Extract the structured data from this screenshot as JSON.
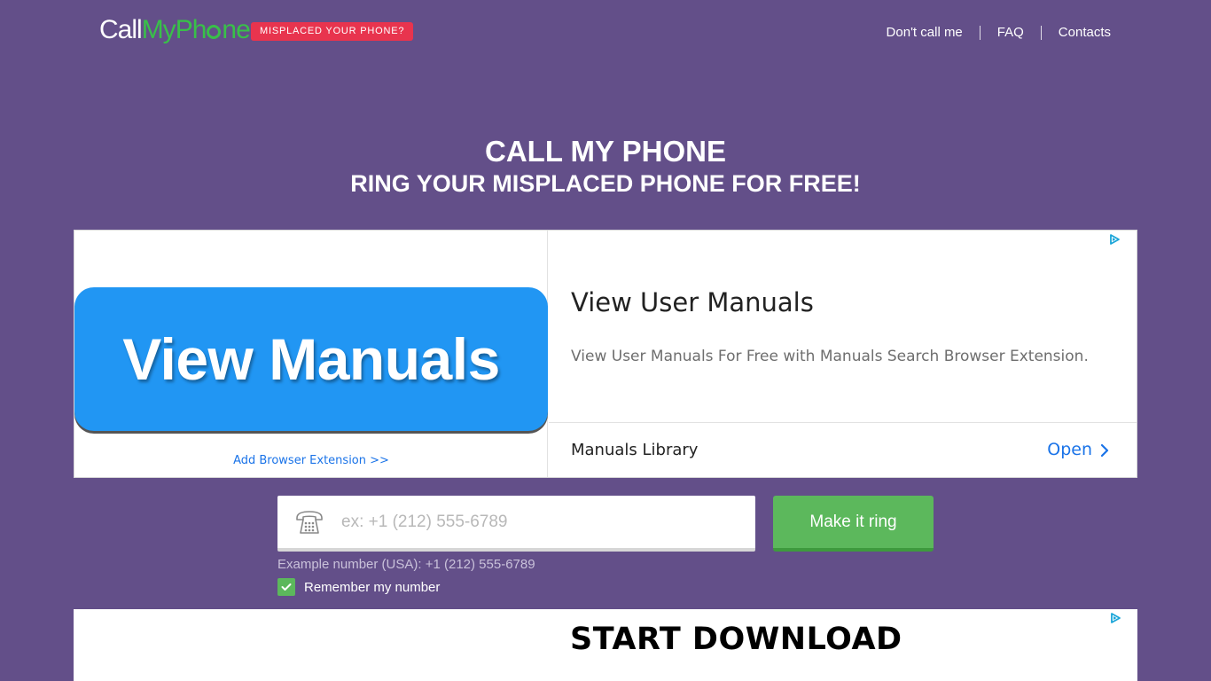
{
  "header": {
    "logo": {
      "call": "Call",
      "my": "My",
      "phone_pre": "Ph",
      "phone_post": "ne"
    },
    "badge": "MISPLACED YOUR PHONE?",
    "nav": [
      {
        "label": "Don't call me"
      },
      {
        "label": "FAQ"
      },
      {
        "label": "Contacts"
      }
    ]
  },
  "hero": {
    "title": "CALL MY PHONE",
    "subtitle": "RING YOUR MISPLACED PHONE FOR FREE!"
  },
  "ad1": {
    "banner_text": "View Manuals",
    "add_extension": "Add Browser Extension >>",
    "title": "View User Manuals",
    "description": "View User Manuals For Free with Manuals Search Browser Extension.",
    "footer_label": "Manuals Library",
    "open_label": "Open"
  },
  "form": {
    "placeholder": "ex: +1 (212) 555-6789",
    "value": "",
    "button_label": "Make it ring",
    "example": "Example number (USA): +1 (212) 555-6789",
    "remember_label": "Remember my number",
    "remember_checked": true
  },
  "ad2": {
    "title": "START DOWNLOAD"
  },
  "colors": {
    "background": "#634f89",
    "accent_green": "#5cb85c",
    "badge_red": "#e8344e",
    "link_blue": "#1a73e8",
    "banner_blue": "#2196f3"
  }
}
